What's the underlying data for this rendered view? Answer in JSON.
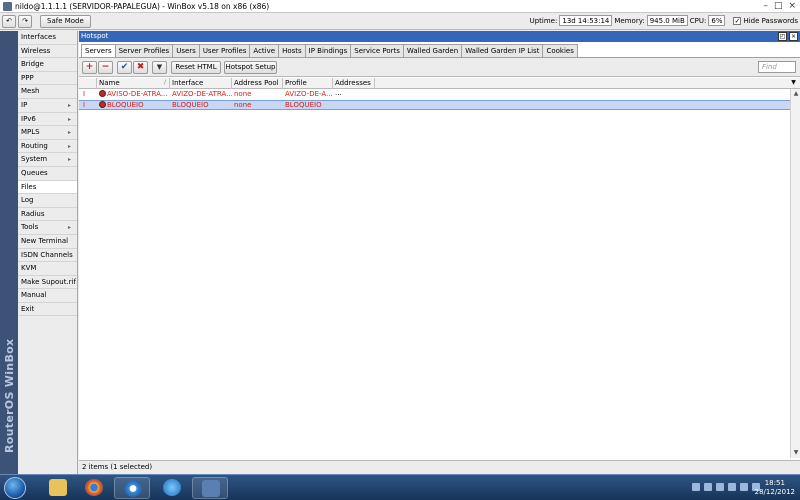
{
  "window": {
    "title": "nildo@1.1.1.1 (SERVIDOR-PAPALEGUA) - WinBox v5.18 on x86 (x86)",
    "minimize": "–",
    "maximize": "□",
    "close": "×"
  },
  "toolbar": {
    "undo_glyph": "↶",
    "redo_glyph": "↷",
    "safe_mode_label": "Safe Mode",
    "uptime_label": "Uptime:",
    "uptime_value": "13d 14:53:14",
    "memory_label": "Memory:",
    "memory_value": "945.0 MiB",
    "cpu_label": "CPU:",
    "cpu_value": "6%",
    "hide_passwords_label": "Hide Passwords",
    "hide_passwords_check": "✓"
  },
  "brand": {
    "text": "RouterOS WinBox"
  },
  "sidebar": {
    "items": [
      {
        "label": "Interfaces",
        "arrow": ""
      },
      {
        "label": "Wireless",
        "arrow": ""
      },
      {
        "label": "Bridge",
        "arrow": ""
      },
      {
        "label": "PPP",
        "arrow": ""
      },
      {
        "label": "Mesh",
        "arrow": ""
      },
      {
        "label": "IP",
        "arrow": "▸"
      },
      {
        "label": "IPv6",
        "arrow": "▸"
      },
      {
        "label": "MPLS",
        "arrow": "▸"
      },
      {
        "label": "Routing",
        "arrow": "▸"
      },
      {
        "label": "System",
        "arrow": "▸"
      },
      {
        "label": "Queues",
        "arrow": ""
      },
      {
        "label": "Files",
        "arrow": ""
      },
      {
        "label": "Log",
        "arrow": ""
      },
      {
        "label": "Radius",
        "arrow": ""
      },
      {
        "label": "Tools",
        "arrow": "▸"
      },
      {
        "label": "New Terminal",
        "arrow": ""
      },
      {
        "label": "ISDN Channels",
        "arrow": ""
      },
      {
        "label": "KVM",
        "arrow": ""
      },
      {
        "label": "Make Supout.rif",
        "arrow": ""
      },
      {
        "label": "Manual",
        "arrow": ""
      },
      {
        "label": "Exit",
        "arrow": ""
      }
    ]
  },
  "hotspot": {
    "title": "Hotspot",
    "restore": "◰",
    "close": "×",
    "tabs": [
      "Servers",
      "Server Profiles",
      "Users",
      "User Profiles",
      "Active",
      "Hosts",
      "IP Bindings",
      "Service Ports",
      "Walled Garden",
      "Walled Garden IP List",
      "Cookies"
    ],
    "buttons": {
      "add": "+",
      "remove": "−",
      "enable": "✔",
      "disable": "✖",
      "filter": "▼",
      "reset_html": "Reset HTML",
      "hotspot_setup": "Hotspot Setup"
    },
    "find_placeholder": "Find",
    "columns": [
      "Name",
      "Interface",
      "Address Pool",
      "Profile",
      "Addresses ..."
    ],
    "rows": [
      {
        "flag": "I",
        "name": "AVISO-DE-ATRA...",
        "interface": "AVIZO-DE-ATRA...",
        "pool": "none",
        "profile": "AVIZO-DE-A..."
      },
      {
        "flag": "I",
        "name": "BLOQUEIO",
        "interface": "BLOQUEIO",
        "pool": "none",
        "profile": "BLOQUEIO"
      }
    ],
    "status": "2 items (1 selected)"
  },
  "taskbar": {
    "time": "18:51",
    "date": "28/12/2012"
  },
  "colors": {
    "accent": "#3567b8",
    "disabled_text": "#d02020",
    "brand_strip": "#3c5276"
  }
}
